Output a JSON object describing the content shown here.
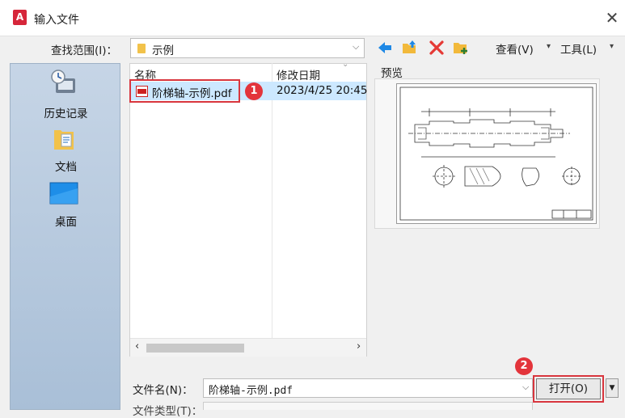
{
  "window": {
    "title": "输入文件",
    "app_icon": "A",
    "close": "✕"
  },
  "lookin": {
    "label": "查找范围(I)：",
    "value": "示例",
    "arrow": "⌵"
  },
  "toolbar": {
    "icons": [
      "back-arrow-icon",
      "folder-up-icon",
      "delete-icon",
      "new-folder-icon"
    ],
    "view_label": "查看(V)",
    "tools_label": "工具(L)",
    "menu_arrow": "▾"
  },
  "places": {
    "items": [
      {
        "label": "历史记录",
        "icon": "history-icon"
      },
      {
        "label": "文档",
        "icon": "documents-folder-icon"
      },
      {
        "label": "桌面",
        "icon": "desktop-icon"
      }
    ]
  },
  "filelist": {
    "columns": [
      "名称",
      "修改日期"
    ],
    "sort_indicator": "⌄",
    "rows": [
      {
        "name": "阶梯轴-示例.pdf",
        "date": "2023/4/25 20:45",
        "selected": true
      }
    ]
  },
  "scroll": {
    "left": "‹",
    "right": "›"
  },
  "preview": {
    "label": "预览"
  },
  "bottom": {
    "filename_label": "文件名(N)：",
    "filename_value": "阶梯轴-示例.pdf",
    "filename_arrow": "⌵",
    "open_label": "打开(O)",
    "dropdown_arrow": "▼",
    "filetype_label": "文件类型(T)："
  },
  "badges": [
    "1",
    "2"
  ],
  "colors": {
    "highlight": "#d8363e",
    "selection": "#cce8ff",
    "places_bg": "#b7cade"
  }
}
